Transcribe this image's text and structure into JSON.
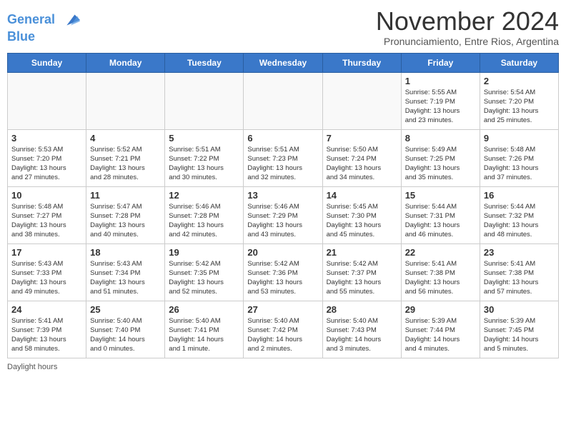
{
  "logo": {
    "line1": "General",
    "line2": "Blue"
  },
  "title": "November 2024",
  "subtitle": "Pronunciamiento, Entre Rios, Argentina",
  "days_of_week": [
    "Sunday",
    "Monday",
    "Tuesday",
    "Wednesday",
    "Thursday",
    "Friday",
    "Saturday"
  ],
  "footer": "Daylight hours",
  "weeks": [
    [
      {
        "day": "",
        "info": ""
      },
      {
        "day": "",
        "info": ""
      },
      {
        "day": "",
        "info": ""
      },
      {
        "day": "",
        "info": ""
      },
      {
        "day": "",
        "info": ""
      },
      {
        "day": "1",
        "info": "Sunrise: 5:55 AM\nSunset: 7:19 PM\nDaylight: 13 hours\nand 23 minutes."
      },
      {
        "day": "2",
        "info": "Sunrise: 5:54 AM\nSunset: 7:20 PM\nDaylight: 13 hours\nand 25 minutes."
      }
    ],
    [
      {
        "day": "3",
        "info": "Sunrise: 5:53 AM\nSunset: 7:20 PM\nDaylight: 13 hours\nand 27 minutes."
      },
      {
        "day": "4",
        "info": "Sunrise: 5:52 AM\nSunset: 7:21 PM\nDaylight: 13 hours\nand 28 minutes."
      },
      {
        "day": "5",
        "info": "Sunrise: 5:51 AM\nSunset: 7:22 PM\nDaylight: 13 hours\nand 30 minutes."
      },
      {
        "day": "6",
        "info": "Sunrise: 5:51 AM\nSunset: 7:23 PM\nDaylight: 13 hours\nand 32 minutes."
      },
      {
        "day": "7",
        "info": "Sunrise: 5:50 AM\nSunset: 7:24 PM\nDaylight: 13 hours\nand 34 minutes."
      },
      {
        "day": "8",
        "info": "Sunrise: 5:49 AM\nSunset: 7:25 PM\nDaylight: 13 hours\nand 35 minutes."
      },
      {
        "day": "9",
        "info": "Sunrise: 5:48 AM\nSunset: 7:26 PM\nDaylight: 13 hours\nand 37 minutes."
      }
    ],
    [
      {
        "day": "10",
        "info": "Sunrise: 5:48 AM\nSunset: 7:27 PM\nDaylight: 13 hours\nand 38 minutes."
      },
      {
        "day": "11",
        "info": "Sunrise: 5:47 AM\nSunset: 7:28 PM\nDaylight: 13 hours\nand 40 minutes."
      },
      {
        "day": "12",
        "info": "Sunrise: 5:46 AM\nSunset: 7:28 PM\nDaylight: 13 hours\nand 42 minutes."
      },
      {
        "day": "13",
        "info": "Sunrise: 5:46 AM\nSunset: 7:29 PM\nDaylight: 13 hours\nand 43 minutes."
      },
      {
        "day": "14",
        "info": "Sunrise: 5:45 AM\nSunset: 7:30 PM\nDaylight: 13 hours\nand 45 minutes."
      },
      {
        "day": "15",
        "info": "Sunrise: 5:44 AM\nSunset: 7:31 PM\nDaylight: 13 hours\nand 46 minutes."
      },
      {
        "day": "16",
        "info": "Sunrise: 5:44 AM\nSunset: 7:32 PM\nDaylight: 13 hours\nand 48 minutes."
      }
    ],
    [
      {
        "day": "17",
        "info": "Sunrise: 5:43 AM\nSunset: 7:33 PM\nDaylight: 13 hours\nand 49 minutes."
      },
      {
        "day": "18",
        "info": "Sunrise: 5:43 AM\nSunset: 7:34 PM\nDaylight: 13 hours\nand 51 minutes."
      },
      {
        "day": "19",
        "info": "Sunrise: 5:42 AM\nSunset: 7:35 PM\nDaylight: 13 hours\nand 52 minutes."
      },
      {
        "day": "20",
        "info": "Sunrise: 5:42 AM\nSunset: 7:36 PM\nDaylight: 13 hours\nand 53 minutes."
      },
      {
        "day": "21",
        "info": "Sunrise: 5:42 AM\nSunset: 7:37 PM\nDaylight: 13 hours\nand 55 minutes."
      },
      {
        "day": "22",
        "info": "Sunrise: 5:41 AM\nSunset: 7:38 PM\nDaylight: 13 hours\nand 56 minutes."
      },
      {
        "day": "23",
        "info": "Sunrise: 5:41 AM\nSunset: 7:38 PM\nDaylight: 13 hours\nand 57 minutes."
      }
    ],
    [
      {
        "day": "24",
        "info": "Sunrise: 5:41 AM\nSunset: 7:39 PM\nDaylight: 13 hours\nand 58 minutes."
      },
      {
        "day": "25",
        "info": "Sunrise: 5:40 AM\nSunset: 7:40 PM\nDaylight: 14 hours\nand 0 minutes."
      },
      {
        "day": "26",
        "info": "Sunrise: 5:40 AM\nSunset: 7:41 PM\nDaylight: 14 hours\nand 1 minute."
      },
      {
        "day": "27",
        "info": "Sunrise: 5:40 AM\nSunset: 7:42 PM\nDaylight: 14 hours\nand 2 minutes."
      },
      {
        "day": "28",
        "info": "Sunrise: 5:40 AM\nSunset: 7:43 PM\nDaylight: 14 hours\nand 3 minutes."
      },
      {
        "day": "29",
        "info": "Sunrise: 5:39 AM\nSunset: 7:44 PM\nDaylight: 14 hours\nand 4 minutes."
      },
      {
        "day": "30",
        "info": "Sunrise: 5:39 AM\nSunset: 7:45 PM\nDaylight: 14 hours\nand 5 minutes."
      }
    ]
  ]
}
